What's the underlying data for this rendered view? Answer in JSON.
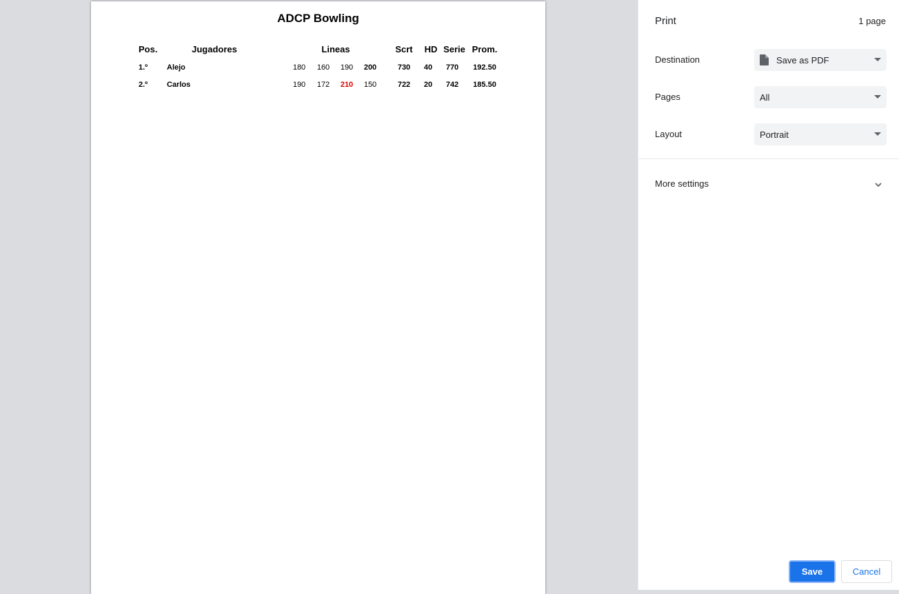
{
  "document": {
    "title": "ADCP Bowling",
    "headers": {
      "pos": "Pos.",
      "players": "Jugadores",
      "lines": "Lineas",
      "scratch": "Scrt",
      "hd": "HD",
      "series": "Serie",
      "average": "Prom."
    },
    "rows": [
      {
        "pos": "1.º",
        "name": "Alejo",
        "line1": "180",
        "line2": "160",
        "line3": "190",
        "line4": "200",
        "scratch": "730",
        "hd": "40",
        "series": "770",
        "average": "192.50"
      },
      {
        "pos": "2.º",
        "name": "Carlos",
        "line1": "190",
        "line2": "172",
        "line3": "210",
        "line4": "150",
        "scratch": "722",
        "hd": "20",
        "series": "742",
        "average": "185.50"
      }
    ],
    "highlight_color": "#e00000"
  },
  "print_panel": {
    "title": "Print",
    "page_count": "1 page",
    "destination": {
      "label": "Destination",
      "value": "Save as PDF",
      "icon": "file-icon"
    },
    "pages": {
      "label": "Pages",
      "value": "All"
    },
    "layout": {
      "label": "Layout",
      "value": "Portrait"
    },
    "more_settings": "More settings",
    "save_label": "Save",
    "cancel_label": "Cancel",
    "accent_color": "#1a73e8"
  }
}
